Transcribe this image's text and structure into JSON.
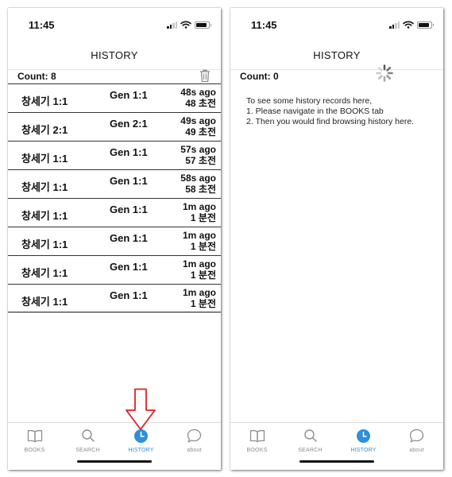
{
  "colors": {
    "accent": "#2e8fda",
    "tab_inactive": "#8e8e8e",
    "annotation_arrow": "#e02020"
  },
  "left_screen": {
    "status_time": "11:45",
    "header_title": "HISTORY",
    "count_label": "Count: 8",
    "rows": [
      {
        "korean": "창세기 1:1",
        "english": "Gen 1:1",
        "time_en": "48s ago",
        "time_ko": "48 초전"
      },
      {
        "korean": "창세기 2:1",
        "english": "Gen 2:1",
        "time_en": "49s ago",
        "time_ko": "49 초전"
      },
      {
        "korean": "창세기 1:1",
        "english": "Gen 1:1",
        "time_en": "57s ago",
        "time_ko": "57 초전"
      },
      {
        "korean": "창세기 1:1",
        "english": "Gen 1:1",
        "time_en": "58s ago",
        "time_ko": "58 초전"
      },
      {
        "korean": "창세기 1:1",
        "english": "Gen 1:1",
        "time_en": "1m ago",
        "time_ko": "1 분전"
      },
      {
        "korean": "창세기 1:1",
        "english": "Gen 1:1",
        "time_en": "1m ago",
        "time_ko": "1 분전"
      },
      {
        "korean": "창세기 1:1",
        "english": "Gen 1:1",
        "time_en": "1m ago",
        "time_ko": "1 분전"
      },
      {
        "korean": "창세기 1:1",
        "english": "Gen 1:1",
        "time_en": "1m ago",
        "time_ko": "1 분전"
      }
    ]
  },
  "right_screen": {
    "status_time": "11:45",
    "header_title": "HISTORY",
    "count_label": "Count: 0",
    "empty_lines": [
      "To see some history records here,",
      "1. Please navigate in the BOOKS tab",
      "2. Then you would find browsing history here."
    ]
  },
  "tabs": [
    {
      "label": "BOOKS",
      "icon": "book-icon"
    },
    {
      "label": "SEARCH",
      "icon": "search-icon"
    },
    {
      "label": "HISTORY",
      "icon": "clock-icon"
    },
    {
      "label": "about",
      "icon": "chat-bubble-icon"
    }
  ]
}
